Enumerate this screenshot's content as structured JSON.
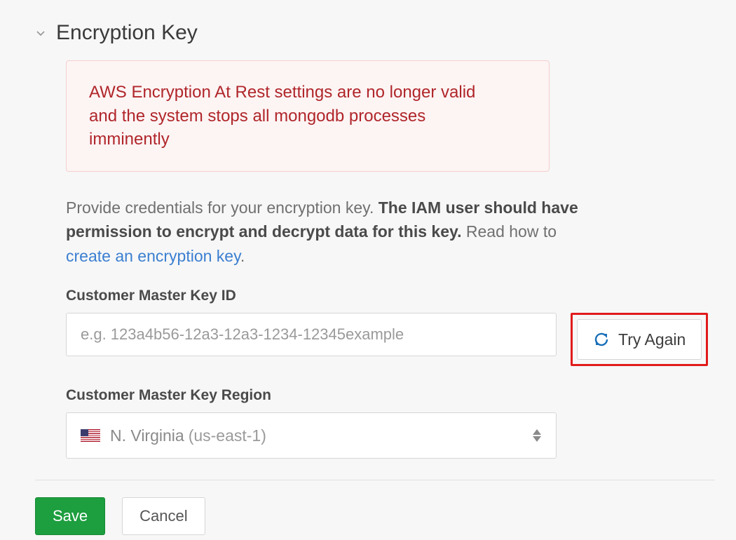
{
  "section": {
    "title": "Encryption Key"
  },
  "alert": {
    "message": "AWS Encryption At Rest settings are no longer valid and the system stops all mongodb processes imminently"
  },
  "description": {
    "part1": "Provide credentials for your encryption key. ",
    "bold": "The IAM user should have permission to encrypt and decrypt data for this key.",
    "part2": " Read how to ",
    "link": "create an encryption key",
    "period": "."
  },
  "fields": {
    "keyId": {
      "label": "Customer Master Key ID",
      "placeholder": "e.g. 123a4b56-12a3-12a3-1234-12345example",
      "value": "",
      "tryAgain": "Try Again"
    },
    "region": {
      "label": "Customer Master Key Region",
      "selectedName": "N. Virginia",
      "selectedCode": "(us-east-1)"
    }
  },
  "actions": {
    "save": "Save",
    "cancel": "Cancel"
  }
}
